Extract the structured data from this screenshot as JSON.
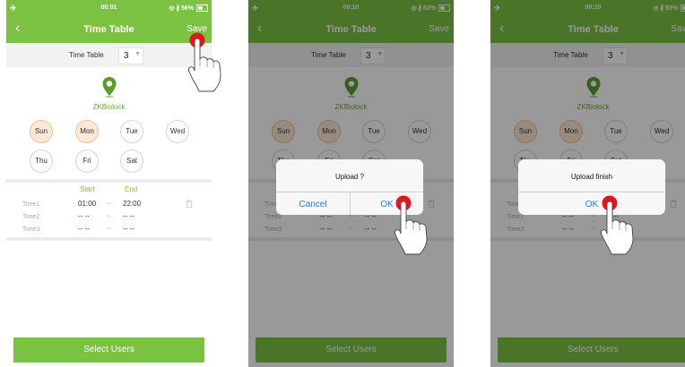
{
  "accent_color": "#7cc242",
  "screens": [
    {
      "status": {
        "time": "00:01",
        "battery": "56%"
      },
      "nav": {
        "back": "‹",
        "title": "Time Table",
        "save": "Save"
      },
      "time_table": {
        "label": "Time Table",
        "value": "3"
      },
      "lock_name": "ZKBiolock",
      "days": [
        "Sun",
        "Mon",
        "Tue",
        "Wed",
        "Thu",
        "Fri",
        "Sat"
      ],
      "headers": {
        "start": "Start",
        "end": "End"
      },
      "rows": [
        {
          "name": "Time1",
          "start": "01:00",
          "sep": "~",
          "end": "22:00"
        },
        {
          "name": "Time2",
          "start": "-- --",
          "sep": "~",
          "end": "-- --"
        },
        {
          "name": "Time3",
          "start": "-- --",
          "sep": "~",
          "end": "-- --"
        }
      ],
      "select_users": "Select Users"
    },
    {
      "status": {
        "time": "00:10",
        "battery": "53%"
      },
      "dialog": {
        "message": "Upload ?",
        "cancel": "Cancel",
        "ok": "OK"
      }
    },
    {
      "status": {
        "time": "00:10",
        "battery": "53%"
      },
      "dialog": {
        "message": "Upload finish",
        "ok": "OK"
      }
    }
  ]
}
